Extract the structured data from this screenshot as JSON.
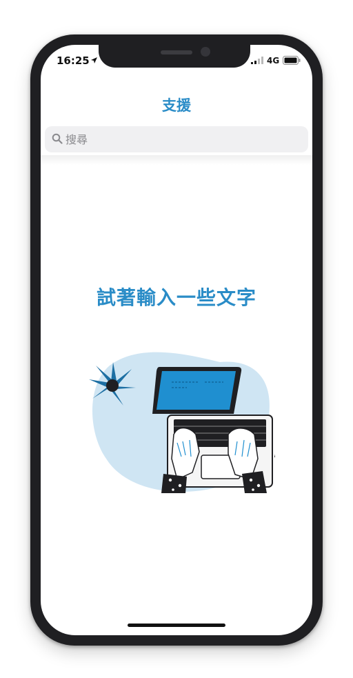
{
  "status_bar": {
    "time": "16:25",
    "network": "4G"
  },
  "nav": {
    "title": "支援"
  },
  "search": {
    "placeholder": "搜尋"
  },
  "empty_state": {
    "message": "試著輸入一些文字"
  },
  "colors": {
    "accent": "#2a8cc7",
    "illustration_bg": "#cfe5f3",
    "laptop_screen": "#1f8fd0",
    "plant": "#1d6fa3",
    "dark": "#1f1f22"
  },
  "icons": [
    "location-arrow-icon",
    "signal-icon",
    "battery-icon",
    "search-icon"
  ]
}
